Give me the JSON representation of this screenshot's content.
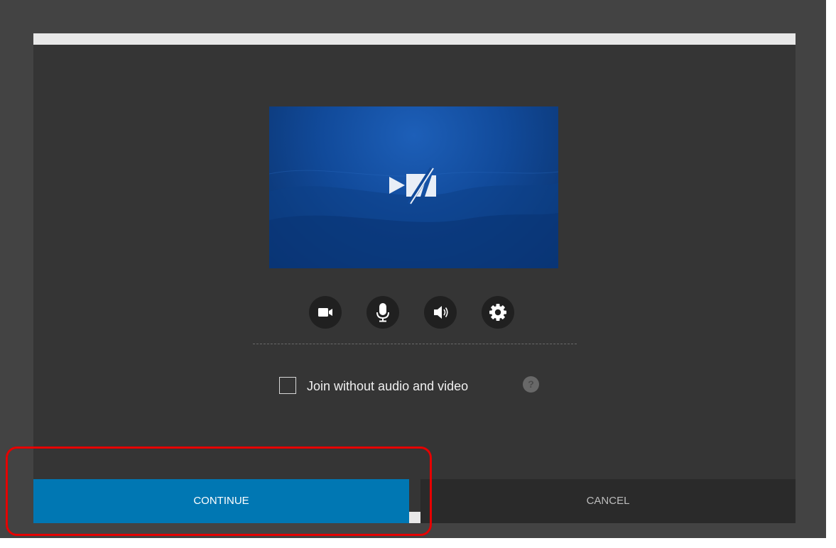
{
  "dialog": {
    "join_without_label": "Join without audio and video",
    "help_glyph": "?",
    "continue_label": "CONTINUE",
    "cancel_label": "CANCEL"
  },
  "controls": [
    {
      "icon": "video-camera-icon",
      "name": "camera-button"
    },
    {
      "icon": "microphone-icon",
      "name": "microphone-button"
    },
    {
      "icon": "speaker-icon",
      "name": "speaker-button"
    },
    {
      "icon": "gear-icon",
      "name": "settings-button"
    }
  ],
  "preview": {
    "icon": "camera-off-icon"
  },
  "colors": {
    "backdrop": "#434343",
    "dialog_body": "#353535",
    "continue_bg": "#0077b3",
    "cancel_bg": "#2a2a2a",
    "highlight": "#e60000",
    "preview_blue": "#114a9a"
  }
}
